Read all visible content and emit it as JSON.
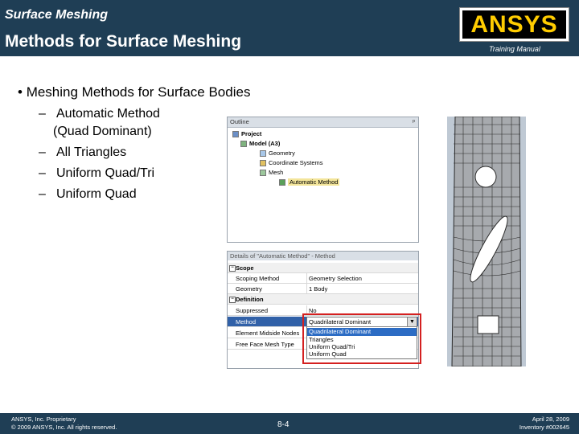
{
  "header": {
    "subtitle": "Surface Meshing",
    "title": "Methods for Surface Meshing",
    "logo_text": "ANSYS",
    "training_label": "Training Manual"
  },
  "content": {
    "bullet": "Meshing Methods for Surface Bodies",
    "sub_items": [
      {
        "dash": "–",
        "text": "Automatic Method",
        "text2": "(Quad Dominant)"
      },
      {
        "dash": "–",
        "text": "All Triangles"
      },
      {
        "dash": "–",
        "text": "Uniform Quad/Tri"
      },
      {
        "dash": "–",
        "text": "Uniform Quad"
      }
    ]
  },
  "outline": {
    "title": "Outline",
    "pin": "ᵖ",
    "items": [
      "Project",
      "Model (A3)",
      "Geometry",
      "Coordinate Systems",
      "Mesh",
      "Automatic Method"
    ]
  },
  "details": {
    "title": "Details of \"Automatic Method\" - Method",
    "scope_group": "Scope",
    "scoping_method_label": "Scoping Method",
    "scoping_method_value": "Geometry Selection",
    "geometry_label": "Geometry",
    "geometry_value": "1 Body",
    "definition_group": "Definition",
    "suppressed_label": "Suppressed",
    "suppressed_value": "No",
    "method_label": "Method",
    "method_value": "Quadrilateral Dominant",
    "midside_label": "Element Midside Nodes",
    "free_face_label": "Free Face Mesh Type",
    "dropdown_options": [
      "Quadrilateral Dominant",
      "Triangles",
      "Uniform Quad/Tri",
      "Uniform Quad"
    ]
  },
  "footer": {
    "left_line1": "ANSYS, Inc. Proprietary",
    "left_line2": "© 2009 ANSYS, Inc. All rights reserved.",
    "page": "8-4",
    "right_line1": "April 28, 2009",
    "right_line2": "Inventory #002645"
  },
  "colors": {
    "header_bg": "#1f3e55",
    "highlight_box": "#d42020",
    "selection": "#2c6cc4",
    "logo_text": "#ffcc00"
  }
}
